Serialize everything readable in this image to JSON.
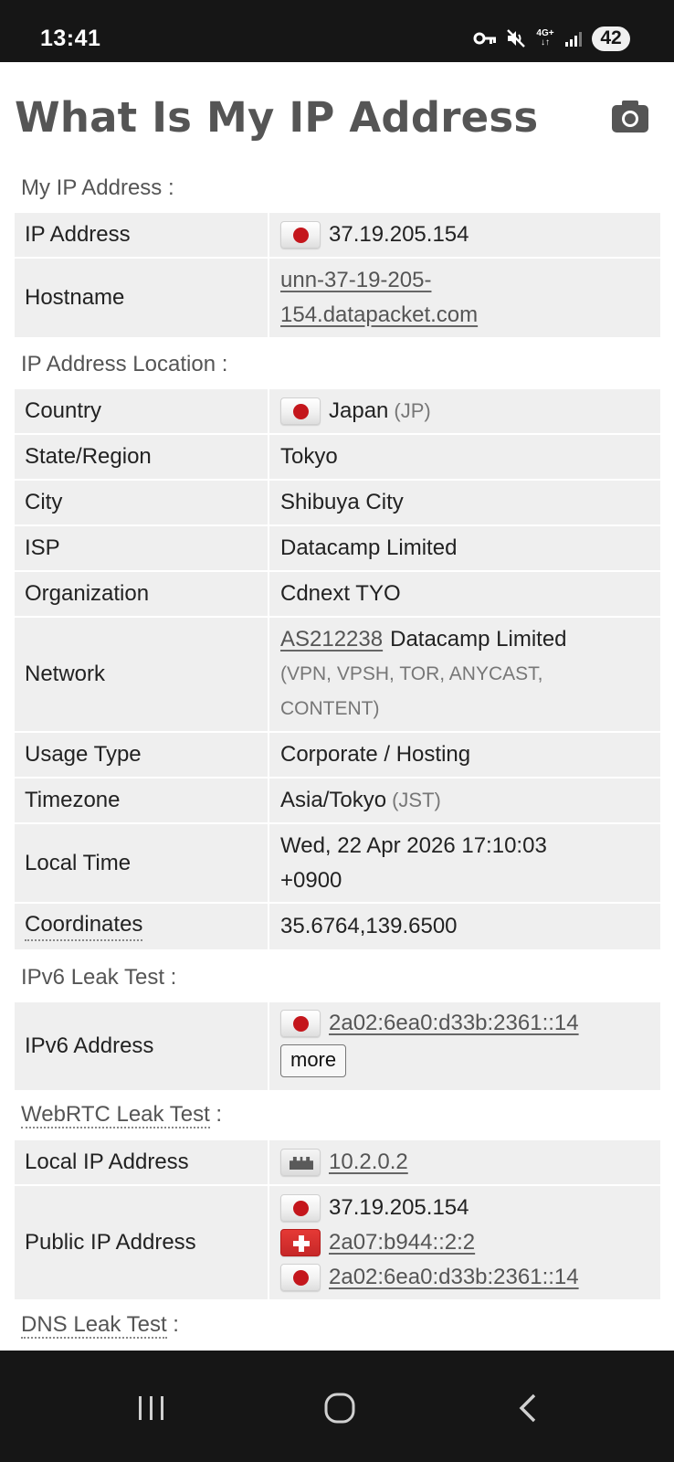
{
  "status_bar": {
    "time": "13:41",
    "network": "4G+",
    "battery": "42",
    "icons": [
      "vpn-key-icon",
      "mute-icon",
      "network-type-icon",
      "signal-icon",
      "battery-icon"
    ]
  },
  "page": {
    "title": "What Is My IP Address",
    "camera_icon": "camera-icon"
  },
  "my_ip": {
    "label": "My IP Address :",
    "rows": {
      "ip_address": {
        "key": "IP Address",
        "value": "37.19.205.154",
        "flag": "jp"
      },
      "hostname": {
        "key": "Hostname",
        "value_line1": "unn-37-19-205-",
        "value_line2": "154.datapacket.com"
      }
    }
  },
  "location": {
    "label": "IP Address Location :",
    "country": {
      "key": "Country",
      "value": "Japan",
      "code": "(JP)",
      "flag": "jp"
    },
    "state": {
      "key": "State/Region",
      "value": "Tokyo"
    },
    "city": {
      "key": "City",
      "value": "Shibuya City"
    },
    "isp": {
      "key": "ISP",
      "value": "Datacamp Limited"
    },
    "organization": {
      "key": "Organization",
      "value": "Cdnext TYO"
    },
    "network": {
      "key": "Network",
      "asn": "AS212238",
      "asn_name": "Datacamp Limited",
      "tags_line1": "(VPN, VPSH, TOR, ANYCAST,",
      "tags_line2": "CONTENT)"
    },
    "usage_type": {
      "key": "Usage Type",
      "value": "Corporate / Hosting"
    },
    "timezone": {
      "key": "Timezone",
      "value": "Asia/Tokyo",
      "abbr": "(JST)"
    },
    "local_time": {
      "key": "Local Time",
      "value_line1": "Wed, 22 Apr 2026 17:10:03",
      "value_line2": "+0900"
    },
    "coordinates": {
      "key": "Coordinates",
      "value": "35.6764,139.6500"
    }
  },
  "ipv6_leak": {
    "label": "IPv6 Leak Test :",
    "ipv6_address": {
      "key": "IPv6 Address",
      "value": "2a02:6ea0:d33b:2361::14",
      "flag": "jp",
      "more_label": "more"
    }
  },
  "webrtc_leak": {
    "label": "WebRTC Leak Test",
    "label_suffix": " :",
    "local_ip": {
      "key": "Local IP Address",
      "value": "10.2.0.2",
      "flag": "lan"
    },
    "public_ip": {
      "key": "Public IP Address",
      "values": [
        {
          "value": "37.19.205.154",
          "flag": "jp"
        },
        {
          "value": "2a07:b944::2:2",
          "flag": "ch"
        },
        {
          "value": "2a02:6ea0:d33b:2361::14",
          "flag": "jp"
        }
      ]
    }
  },
  "dns_leak": {
    "label": "DNS Leak Test",
    "label_suffix": " :"
  },
  "nav_bar": {
    "icons": [
      "recent-apps-icon",
      "home-icon",
      "back-icon"
    ]
  }
}
